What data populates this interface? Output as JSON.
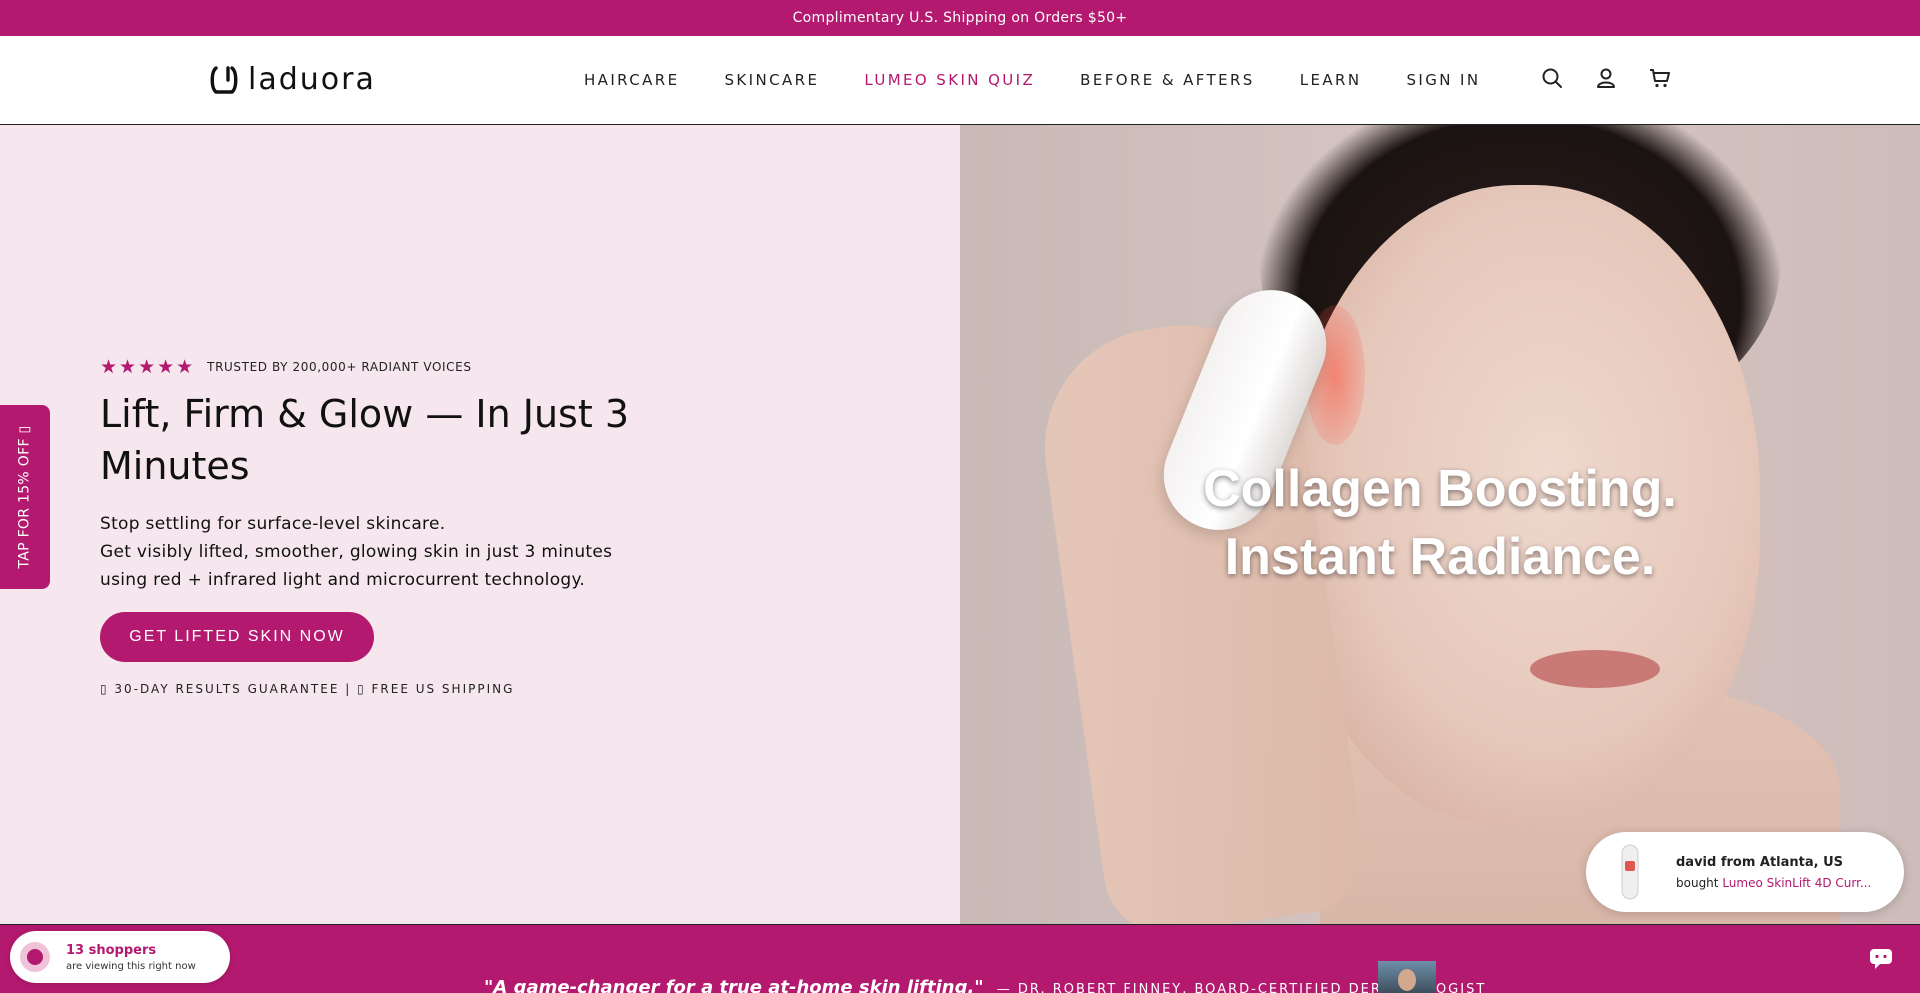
{
  "announcement": {
    "text": "Complimentary U.S. Shipping on Orders $50+"
  },
  "header": {
    "logo_text": "laduora",
    "nav": [
      {
        "label": "HAIRCARE"
      },
      {
        "label": "SKINCARE"
      },
      {
        "label": "LUMEO SKIN QUIZ",
        "active": true
      },
      {
        "label": "BEFORE & AFTERS"
      },
      {
        "label": "LEARN"
      },
      {
        "label": "SIGN IN"
      }
    ],
    "icons": [
      "search-icon",
      "account-icon",
      "cart-icon"
    ]
  },
  "hero": {
    "rating_stars": 5,
    "trusted": "TRUSTED BY 200,000+ RADIANT VOICES",
    "title": "Lift, Firm & Glow — In Just 3 Minutes",
    "desc_line1": "Stop settling for surface-level skincare.",
    "desc_line2": "Get visibly lifted, smoother, glowing skin in just 3 minutes using red + infrared light and microcurrent technology.",
    "cta": "GET LIFTED SKIN NOW",
    "guarantee": "▯ 30-DAY RESULTS GUARANTEE | ▯ FREE US SHIPPING",
    "image_text_line1": "Collagen Boosting.",
    "image_text_line2": "Instant Radiance."
  },
  "side_tab": {
    "label": "TAP FOR 15% OFF ▯"
  },
  "purchase_popup": {
    "name": "david from Atlanta, US",
    "bought": "bought",
    "product": "Lumeo SkinLift 4D Curr..."
  },
  "testimonial": {
    "quote": "\"A game-changer for a true at-home skin lifting.\"",
    "attribution": "— DR. ROBERT FINNEY, BOARD-CERTIFIED DERMATOLOGIST"
  },
  "shoppers": {
    "count": "13 shoppers",
    "subtitle": "are viewing this right now"
  },
  "colors": {
    "brand": "#b3196e",
    "hero_bg": "#f6e7ee"
  }
}
